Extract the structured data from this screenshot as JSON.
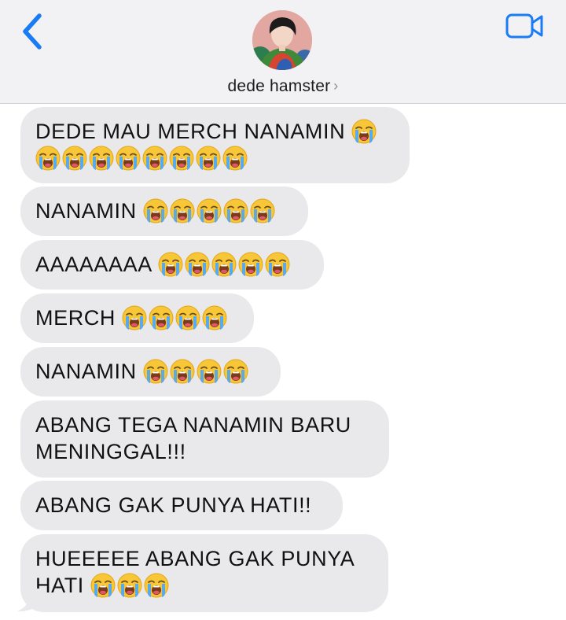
{
  "header": {
    "back_icon": "chevron-left-icon",
    "contact_name": "dede hamster",
    "contact_chevron": "›",
    "video_icon": "video-camera-icon",
    "accent_color": "#1a7cf5"
  },
  "messages": [
    {
      "text": "DEDE MAU MERCH NANAMIN",
      "emoji": "loudly-crying-face",
      "emoji_count": 9,
      "line2": ""
    },
    {
      "text": "NANAMIN",
      "emoji": "loudly-crying-face",
      "emoji_count": 5,
      "line2": ""
    },
    {
      "text": "AAAAAAAA",
      "emoji": "loudly-crying-face",
      "emoji_count": 5,
      "line2": ""
    },
    {
      "text": "MERCH",
      "emoji": "loudly-crying-face",
      "emoji_count": 4,
      "line2": ""
    },
    {
      "text": "NANAMIN",
      "emoji": "loudly-crying-face",
      "emoji_count": 4,
      "line2": ""
    },
    {
      "text": "ABANG TEGA NANAMIN BARU",
      "emoji": "",
      "emoji_count": 0,
      "line2": "MENINGGAL!!!"
    },
    {
      "text": "ABANG GAK PUNYA HATI!!",
      "emoji": "",
      "emoji_count": 0,
      "line2": ""
    },
    {
      "text": "HUEEEEE ABANG GAK PUNYA",
      "emoji": "loudly-crying-face",
      "emoji_count": 3,
      "line2": "HATI"
    }
  ]
}
